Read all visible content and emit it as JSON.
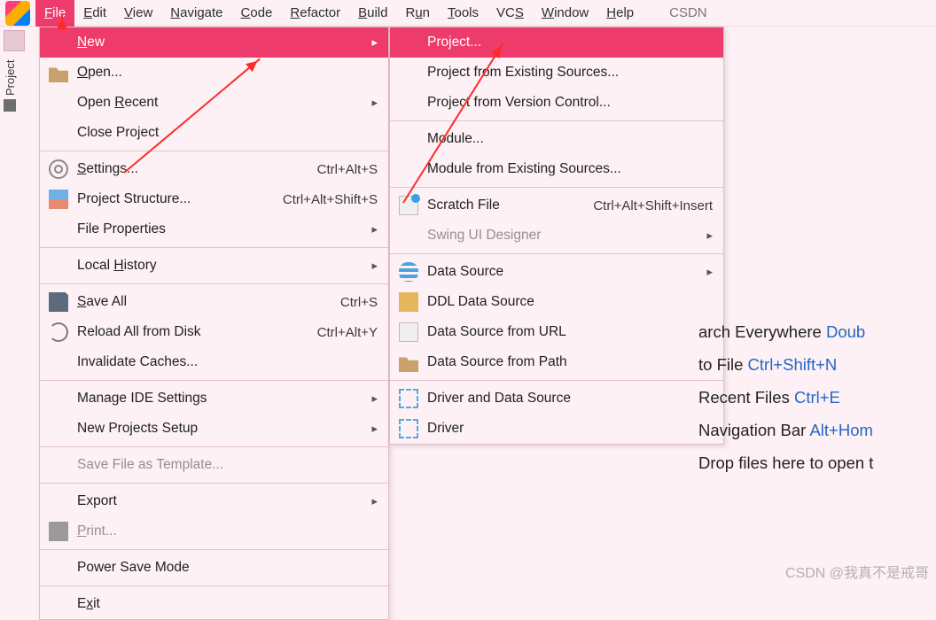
{
  "menubar": {
    "items": [
      {
        "label": "File",
        "mn": "F",
        "active": true
      },
      {
        "label": "Edit",
        "mn": "E"
      },
      {
        "label": "View",
        "mn": "V"
      },
      {
        "label": "Navigate",
        "mn": "N"
      },
      {
        "label": "Code",
        "mn": "C"
      },
      {
        "label": "Refactor",
        "mn": "R"
      },
      {
        "label": "Build",
        "mn": "B"
      },
      {
        "label": "Run",
        "mn": "u"
      },
      {
        "label": "Tools",
        "mn": "T"
      },
      {
        "label": "VCS",
        "mn": "S"
      },
      {
        "label": "Window",
        "mn": "W"
      },
      {
        "label": "Help",
        "mn": "H"
      }
    ],
    "trail": "CSDN"
  },
  "sidebar": {
    "tool_label": "Project"
  },
  "file_menu": [
    {
      "label": "New",
      "mn": "N",
      "submenu": true,
      "selected": true,
      "icon": "blank"
    },
    {
      "label": "Open...",
      "mn": "O",
      "icon": "folder"
    },
    {
      "label": "Open Recent",
      "mn": "R",
      "submenu": true,
      "icon": "blank"
    },
    {
      "label": "Close Project",
      "icon": "blank"
    },
    {
      "sep": true
    },
    {
      "label": "Settings...",
      "mn": "S",
      "shortcut": "Ctrl+Alt+S",
      "icon": "gear"
    },
    {
      "label": "Project Structure...",
      "shortcut": "Ctrl+Alt+Shift+S",
      "icon": "struct"
    },
    {
      "label": "File Properties",
      "submenu": true,
      "icon": "blank"
    },
    {
      "sep": true
    },
    {
      "label": "Local History",
      "mn": "H",
      "submenu": true,
      "icon": "blank"
    },
    {
      "sep": true
    },
    {
      "label": "Save All",
      "mn": "S",
      "shortcut": "Ctrl+S",
      "icon": "save"
    },
    {
      "label": "Reload All from Disk",
      "shortcut": "Ctrl+Alt+Y",
      "icon": "reload"
    },
    {
      "label": "Invalidate Caches...",
      "icon": "blank"
    },
    {
      "sep": true
    },
    {
      "label": "Manage IDE Settings",
      "submenu": true,
      "icon": "blank"
    },
    {
      "label": "New Projects Setup",
      "submenu": true,
      "icon": "blank"
    },
    {
      "sep": true
    },
    {
      "label": "Save File as Template...",
      "disabled": true,
      "icon": "blank"
    },
    {
      "sep": true
    },
    {
      "label": "Export",
      "submenu": true,
      "icon": "blank"
    },
    {
      "label": "Print...",
      "mn": "P",
      "disabled": true,
      "icon": "print"
    },
    {
      "sep": true
    },
    {
      "label": "Power Save Mode",
      "icon": "blank"
    },
    {
      "sep": true
    },
    {
      "label": "Exit",
      "mn": "x",
      "icon": "blank"
    }
  ],
  "new_menu": [
    {
      "label": "Project...",
      "selected": true,
      "icon": "blank"
    },
    {
      "label": "Project from Existing Sources...",
      "icon": "blank"
    },
    {
      "label": "Project from Version Control...",
      "icon": "blank"
    },
    {
      "sep": true
    },
    {
      "label": "Module...",
      "icon": "blank"
    },
    {
      "label": "Module from Existing Sources...",
      "icon": "blank"
    },
    {
      "sep": true
    },
    {
      "label": "Scratch File",
      "shortcut": "Ctrl+Alt+Shift+Insert",
      "icon": "scratch"
    },
    {
      "label": "Swing UI Designer",
      "submenu": true,
      "disabled": true,
      "icon": "blank"
    },
    {
      "sep": true
    },
    {
      "label": "Data Source",
      "submenu": true,
      "icon": "db"
    },
    {
      "label": "DDL Data Source",
      "icon": "ddl"
    },
    {
      "label": "Data Source from URL",
      "icon": "file"
    },
    {
      "label": "Data Source from Path",
      "icon": "folder"
    },
    {
      "sep": true
    },
    {
      "label": "Driver and Data Source",
      "icon": "driver"
    },
    {
      "label": "Driver",
      "icon": "driver"
    }
  ],
  "hints": [
    {
      "text": "arch Everywhere ",
      "kb": "Doub"
    },
    {
      "text": " to File ",
      "kb": "Ctrl+Shift+N"
    },
    {
      "text": "Recent Files ",
      "kb": "Ctrl+E"
    },
    {
      "text": "Navigation Bar ",
      "kb": "Alt+Hom"
    },
    {
      "text": "Drop files here to open t",
      "kb": ""
    }
  ],
  "watermark": "CSDN @我真不是戒哥"
}
